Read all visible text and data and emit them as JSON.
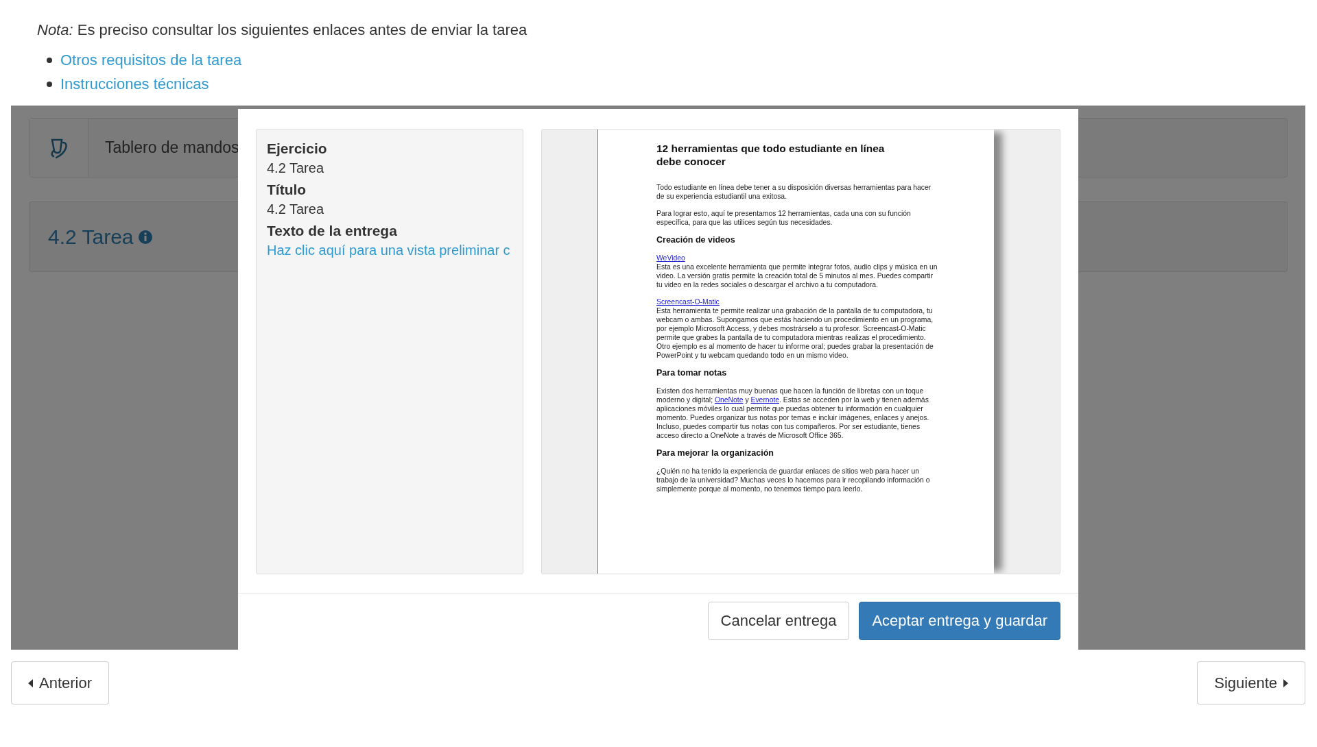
{
  "note": "*Nota:* Es preciso consultar los siguientes enlaces antes de enviar la tarea",
  "links": [
    "Otros requisitos de la tarea",
    "Instrucciones técnicas"
  ],
  "background": {
    "dashboard": "Tablero de mandos",
    "title": "4.2 Tarea"
  },
  "dialog": {
    "fields": [
      {
        "label": "Ejercicio",
        "kind": "text",
        "value": "4.2 Tarea"
      },
      {
        "label": "Título",
        "kind": "text",
        "value": "4.2 Tarea"
      },
      {
        "label": "Texto de la entrega",
        "kind": "link",
        "value": "Haz clic aquí para una vista preliminar c"
      }
    ],
    "document": {
      "title": "12 herramientas que todo estudiante en línea debe conocer",
      "blocks": [
        {
          "kind": "paragraph",
          "parts": [
            {
              "kind": "text",
              "text": "Todo estudiante en línea debe tener a su disposición diversas herramientas para hacer de su experiencia estudiantil una exitosa."
            }
          ]
        },
        {
          "kind": "paragraph",
          "parts": [
            {
              "kind": "text",
              "text": "Para lograr esto, aquí te presentamos 12 herramientas, cada una con su función específica, para que las utilices según tus necesidades."
            }
          ]
        },
        {
          "kind": "heading",
          "text": "Creación de videos"
        },
        {
          "kind": "entry",
          "link": "WeVideo",
          "text": "Esta es una excelente herramienta que permite integrar fotos, audio clips y música en un video. La versión gratis permite la creación total de 5 minutos al mes. Puedes compartir tu video en la redes sociales o descargar el archivo a tu computadora."
        },
        {
          "kind": "entry",
          "link": "Screencast-O-Matic",
          "text": "Esta herramienta te permite realizar una grabación de la pantalla de tu computadora, tu webcam o ambas. Supongamos que estás haciendo un procedimiento en un programa, por ejemplo Microsoft Access, y debes mostrárselo a tu profesor. Screencast-O-Matic permite que grabes la pantalla de tu computadora mientras realizas el procedimiento. Otro ejemplo es al momento de hacer tu informe oral; puedes grabar la presentación de PowerPoint y tu webcam quedando todo en un mismo video."
        },
        {
          "kind": "heading",
          "text": "Para tomar notas"
        },
        {
          "kind": "paragraph",
          "parts": [
            {
              "kind": "text",
              "text": "Existen dos herramientas muy buenas que hacen la función de libretas con un toque moderno y digital; "
            },
            {
              "kind": "link",
              "text": "OneNote"
            },
            {
              "kind": "text",
              "text": " y "
            },
            {
              "kind": "link",
              "text": "Evernote"
            },
            {
              "kind": "text",
              "text": ". Estas se acceden por la web y tienen además aplicaciones móviles lo cual permite que puedas obtener tu información en cualquier momento. Puedes organizar tus notas por temas e incluir imágenes, enlaces y anejos. Incluso, puedes compartir tus notas con tus compañeros. Por ser estudiante, tienes acceso directo a OneNote a través de Microsoft Office 365."
            }
          ]
        },
        {
          "kind": "heading",
          "text": "Para mejorar la organización"
        },
        {
          "kind": "paragraph",
          "parts": [
            {
              "kind": "text",
              "text": "¿Quién no ha tenido la experiencia de guardar enlaces de sitios web para hacer un trabajo de la universidad? Muchas veces lo hacemos para ir recopilando información o simplemente porque al momento, no tenemos tiempo para leerlo."
            }
          ]
        }
      ]
    },
    "buttons": [
      {
        "label": "Cancelar entrega",
        "kind": "secondary"
      },
      {
        "label": "Aceptar entrega y guardar",
        "kind": "primary"
      }
    ]
  },
  "pager": {
    "previous": "Anterior",
    "next": "Siguiente"
  }
}
